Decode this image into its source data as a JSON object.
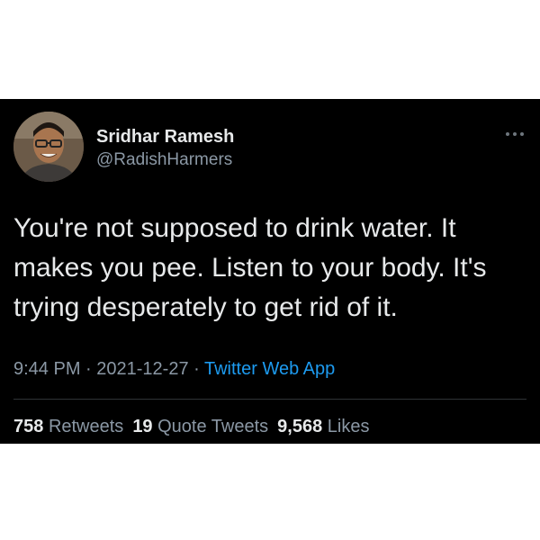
{
  "user": {
    "display_name": "Sridhar Ramesh",
    "handle": "@RadishHarmers"
  },
  "more_icon": "ellipsis-icon",
  "tweet": {
    "lines": [
      "You're not supposed to drink water. It",
      "makes you pee. Listen to your body. It's",
      "trying desperately to get rid of it."
    ]
  },
  "meta": {
    "time": "9:44 PM",
    "sep1": " · ",
    "date": "2021-12-27",
    "sep2": " · ",
    "source": "Twitter Web App"
  },
  "stats": {
    "retweets_count": "758",
    "retweets_label": "Retweets",
    "quotes_count": "19",
    "quotes_label": "Quote Tweets",
    "likes_count": "9,568",
    "likes_label": "Likes"
  },
  "colors": {
    "background": "#000000",
    "text": "#e7e9ea",
    "secondary": "#8b98a5",
    "link": "#1d9bf0"
  }
}
